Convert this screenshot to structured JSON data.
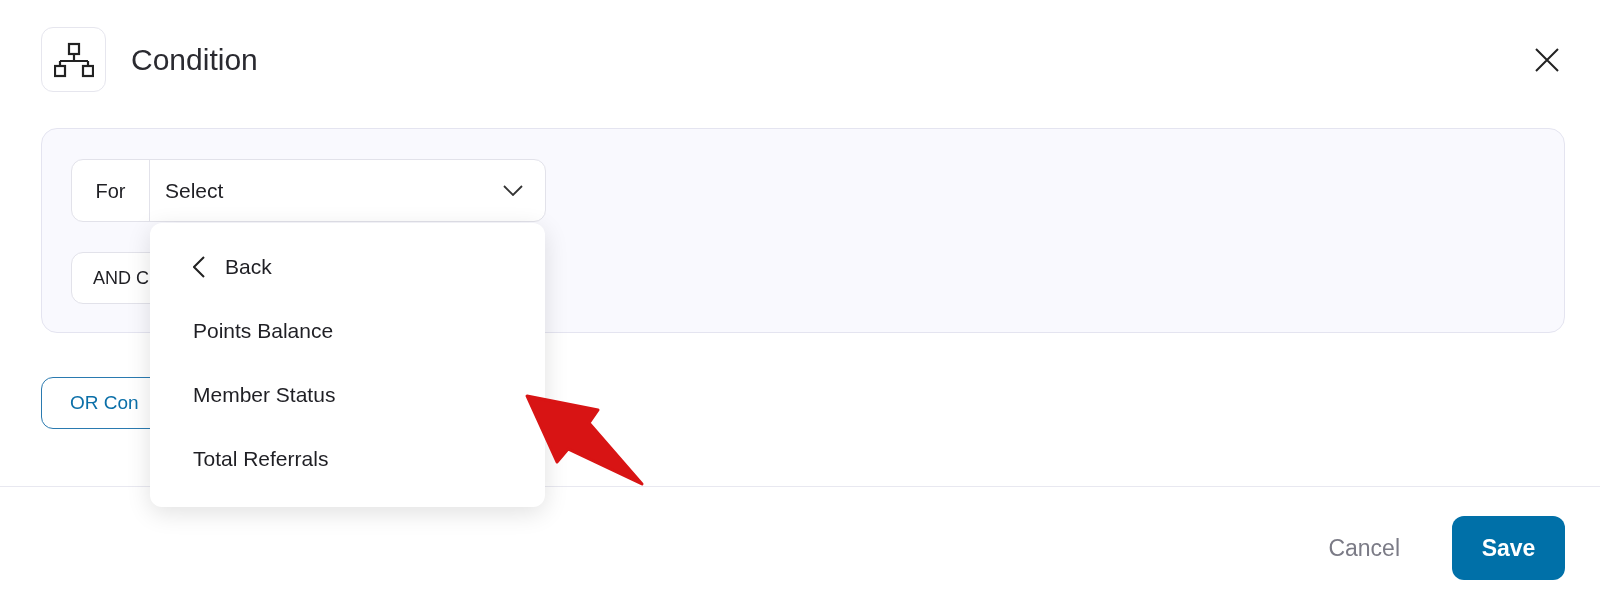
{
  "dialog": {
    "title": "Condition"
  },
  "condition": {
    "for_label": "For",
    "select_value": "Select",
    "and_button": "AND C"
  },
  "or_button": "OR Con",
  "menu": [
    {
      "kind": "back",
      "label": "Back"
    },
    {
      "kind": "option",
      "label": "Points Balance"
    },
    {
      "kind": "option",
      "label": "Member Status"
    },
    {
      "kind": "option",
      "label": "Total Referrals"
    }
  ],
  "footer": {
    "cancel": "Cancel",
    "save": "Save"
  }
}
